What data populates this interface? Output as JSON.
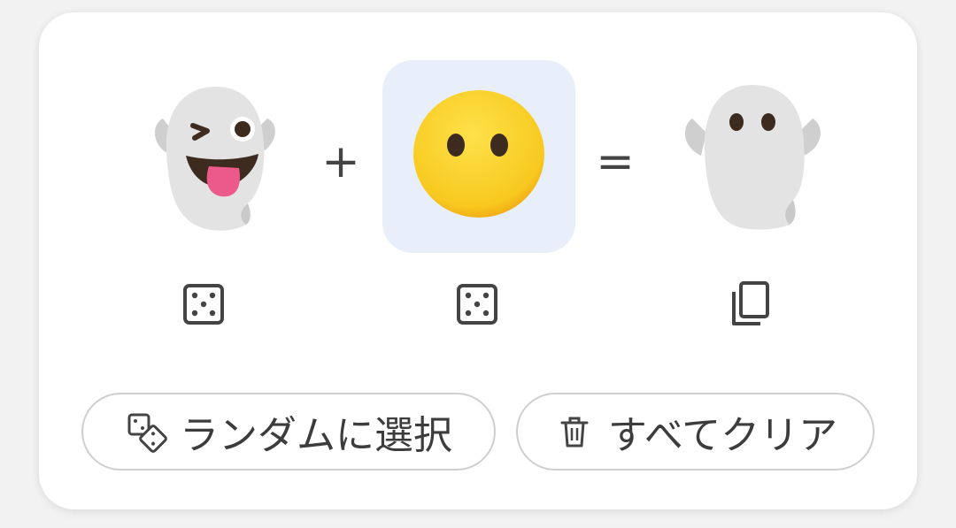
{
  "mixer": {
    "left_emoji": "winking-tongue-ghost-icon",
    "right_emoji": "no-mouth-face-icon",
    "result_emoji": "plain-ghost-icon",
    "plus_symbol": "+",
    "equals_symbol": "=",
    "selected_slot": "right"
  },
  "actions": {
    "left_dice": "dice-icon",
    "right_dice": "dice-icon",
    "copy": "copy-icon"
  },
  "buttons": {
    "random_label": "ランダムに選択",
    "clear_label": "すべてクリア"
  },
  "colors": {
    "card_bg": "#ffffff",
    "selected_slot_bg": "#e8effb",
    "icon_gray": "#444444",
    "ghost_body": "#e0e0e0",
    "face_yellow": "#fbd52e"
  }
}
